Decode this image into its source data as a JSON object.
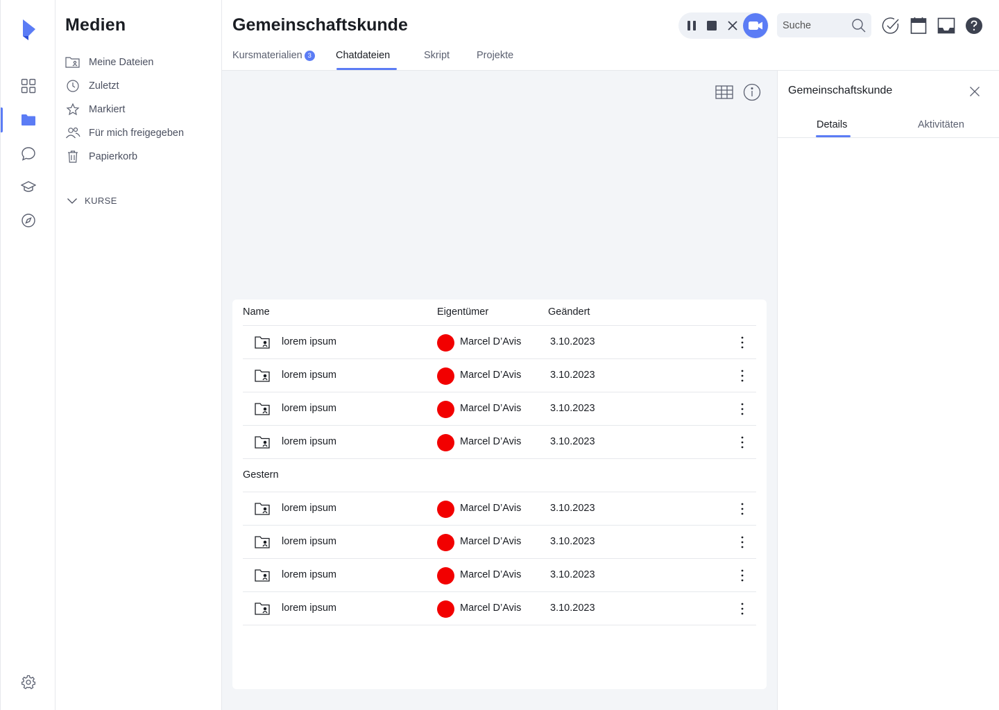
{
  "rail": {
    "items": [
      {
        "name": "dashboard",
        "icon": "grid-icon"
      },
      {
        "name": "media",
        "icon": "folder-icon",
        "active": true
      },
      {
        "name": "chat",
        "icon": "chat-bubble-icon"
      },
      {
        "name": "courses",
        "icon": "graduation-cap-icon"
      },
      {
        "name": "explore",
        "icon": "compass-icon"
      }
    ],
    "settings_icon": "gear-icon"
  },
  "media": {
    "title": "Medien",
    "items": [
      {
        "label": "Meine Dateien",
        "icon": "folder-user-icon"
      },
      {
        "label": "Zuletzt",
        "icon": "clock-icon"
      },
      {
        "label": "Markiert",
        "icon": "star-icon"
      },
      {
        "label": "Für mich freigegeben",
        "icon": "users-icon"
      },
      {
        "label": "Papierkorb",
        "icon": "trash-icon"
      }
    ],
    "courses_label": "KURSE"
  },
  "header": {
    "title": "Gemeinschaftskunde",
    "tabs": [
      {
        "label": "Kursmaterialien",
        "badge": "3"
      },
      {
        "label": "Chatdateien",
        "active": true
      },
      {
        "label": "Skript"
      },
      {
        "label": "Projekte"
      }
    ],
    "search_placeholder": "Suche"
  },
  "table": {
    "columns": [
      "Name",
      "Eigentümer",
      "Geändert"
    ],
    "rows_today": [
      {
        "name": "lorem ipsum",
        "owner": "Marcel D’Avis",
        "date": "3.10.2023"
      },
      {
        "name": "lorem ipsum",
        "owner": "Marcel D’Avis",
        "date": "3.10.2023"
      },
      {
        "name": "lorem ipsum",
        "owner": "Marcel D’Avis",
        "date": "3.10.2023"
      },
      {
        "name": "lorem ipsum",
        "owner": "Marcel D’Avis",
        "date": "3.10.2023"
      }
    ],
    "group_label": "Gestern",
    "rows_yesterday": [
      {
        "name": "lorem ipsum",
        "owner": "Marcel D’Avis",
        "date": "3.10.2023"
      },
      {
        "name": "lorem ipsum",
        "owner": "Marcel D’Avis",
        "date": "3.10.2023"
      },
      {
        "name": "lorem ipsum",
        "owner": "Marcel D’Avis",
        "date": "3.10.2023"
      },
      {
        "name": "lorem ipsum",
        "owner": "Marcel D’Avis",
        "date": "3.10.2023"
      }
    ]
  },
  "panel": {
    "title": "Gemeinschaftskunde",
    "tabs": [
      {
        "label": "Details",
        "active": true
      },
      {
        "label": "Aktivitäten"
      }
    ]
  },
  "colors": {
    "accent": "#5b7cf5",
    "avatar": "#f20000",
    "content_bg": "#f3f5f8"
  }
}
